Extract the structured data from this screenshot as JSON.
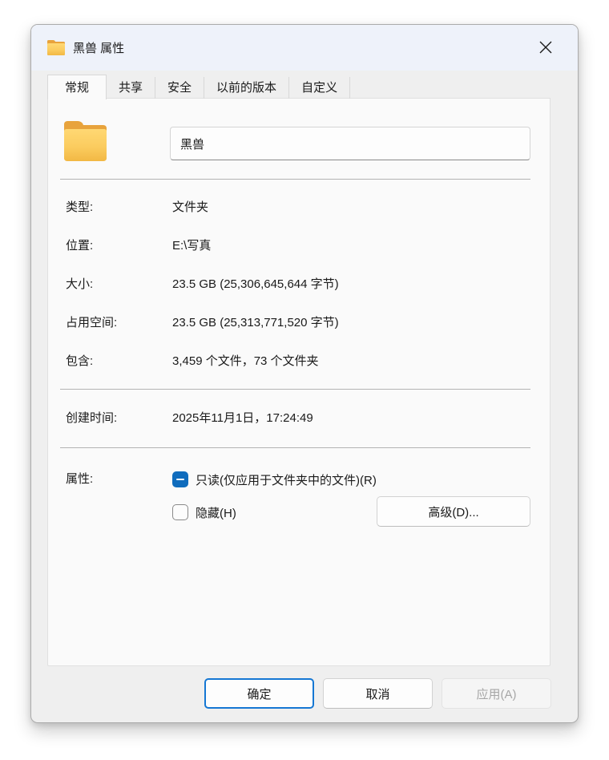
{
  "window": {
    "title": "黑兽 属性",
    "icon": "folder-icon"
  },
  "tabs": [
    {
      "label": "常规",
      "active": true
    },
    {
      "label": "共享",
      "active": false
    },
    {
      "label": "安全",
      "active": false
    },
    {
      "label": "以前的版本",
      "active": false
    },
    {
      "label": "自定义",
      "active": false
    }
  ],
  "general": {
    "name_value": "黑兽",
    "rows": [
      {
        "label": "类型:",
        "value": "文件夹"
      },
      {
        "label": "位置:",
        "value": "E:\\写真"
      },
      {
        "label": "大小:",
        "value": "23.5 GB (25,306,645,644 字节)"
      },
      {
        "label": "占用空间:",
        "value": "23.5 GB (25,313,771,520 字节)"
      },
      {
        "label": "包含:",
        "value": "3,459 个文件，73 个文件夹"
      }
    ],
    "created": {
      "label": "创建时间:",
      "value": "2025年11月1日，17:24:49"
    },
    "attributes": {
      "label": "属性:",
      "readonly": {
        "label": "只读(仅应用于文件夹中的文件)(R)",
        "state": "indeterminate"
      },
      "hidden": {
        "label": "隐藏(H)",
        "state": "unchecked"
      },
      "advanced_label": "高级(D)..."
    }
  },
  "footer": {
    "ok_label": "确定",
    "cancel_label": "取消",
    "apply_label": "应用(A)",
    "apply_disabled": true
  },
  "colors": {
    "accent": "#0f6cbd",
    "ok_border": "#1577d3",
    "titlebar_bg": "#eef2fa",
    "dialog_bg": "#efefef",
    "panel_bg": "#fafafa",
    "folder_front": "#fbcc5f",
    "folder_back": "#e8a33c"
  }
}
